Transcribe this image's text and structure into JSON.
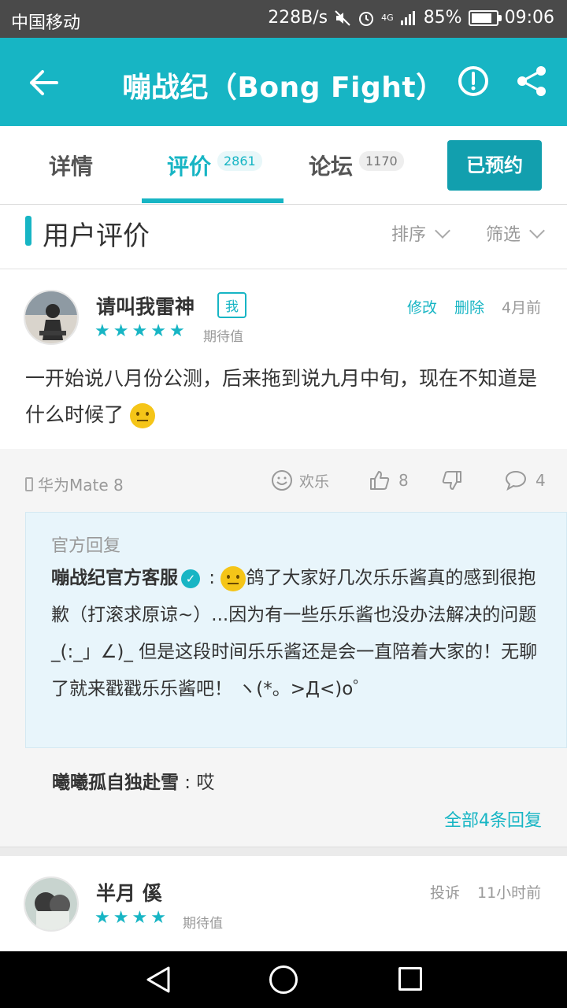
{
  "status_bar": {
    "carrier": "中国移动",
    "speed": "228B/s",
    "network": "4G",
    "battery": "85%",
    "battery_level": 0.85,
    "time": "09:06"
  },
  "app_bar": {
    "title": "嘣战纪（Bong Fight）"
  },
  "tabs": [
    {
      "label": "详情",
      "count": ""
    },
    {
      "label": "评价",
      "count": "2861"
    },
    {
      "label": "论坛",
      "count": "1170"
    }
  ],
  "active_tab": 1,
  "reserve_button": "已预约",
  "section": {
    "title": "用户评价",
    "sort": "排序",
    "filter": "筛选"
  },
  "review1": {
    "username": "请叫我雷神",
    "me_badge": "我",
    "rating": 5,
    "status": "期待值",
    "edit": "修改",
    "delete": "删除",
    "time": "4月前",
    "text": "一开始说八月份公测，后来拖到说九月中旬，现在不知道是什么时候了",
    "device": "华为Mate 8",
    "fun_label": "欢乐",
    "likes": "8",
    "comments": "4"
  },
  "official_reply": {
    "label": "官方回复",
    "name": "嘣战纪官方客服",
    "separator": " : ",
    "text": "鸽了大家好几次乐乐酱真的感到很抱歉（打滚求原谅~）...因为有一些乐乐酱也没办法解决的问题_(:_」∠)_ 但是这段时间乐乐酱还是会一直陪着大家的！无聊了就来戳戳乐乐酱吧！ ヽ(*。>Д<)o゜"
  },
  "sub_reply": {
    "name": "曦曦孤自独赴雪",
    "separator": " : ",
    "text": "哎"
  },
  "all_replies": "全部4条回复",
  "review2": {
    "username": "半月  傒",
    "rating": 4,
    "status": "期待值",
    "report": "投诉",
    "time": "11小时前"
  },
  "colors": {
    "accent": "#17b5c4",
    "status_bar": "#4a4a4a",
    "official_bg": "#e8f5fb"
  }
}
